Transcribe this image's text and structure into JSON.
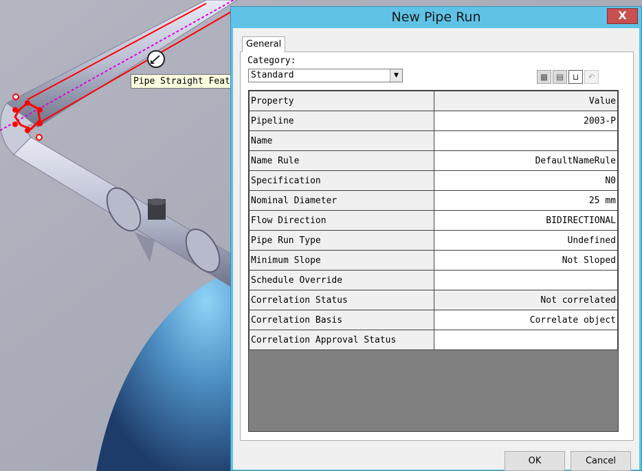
{
  "viewport": {
    "tooltip": "Pipe Straight Feature"
  },
  "dialog": {
    "title": "New Pipe Run",
    "close_label": "X",
    "tab_label": "General",
    "category_label": "Category:",
    "category_value": "Standard",
    "toolbar_icons": [
      "structure-icon",
      "open-folder-icon",
      "pipe-icon",
      "undo-icon"
    ],
    "table_header": {
      "property": "Property",
      "value": "Value"
    },
    "rows": [
      {
        "property": "Pipeline",
        "value": "2003-P"
      },
      {
        "property": "Name",
        "value": ""
      },
      {
        "property": "Name Rule",
        "value": "DefaultNameRule"
      },
      {
        "property": "Specification",
        "value": "N0"
      },
      {
        "property": "Nominal Diameter",
        "value": "25 mm"
      },
      {
        "property": "Flow Direction",
        "value": "BIDIRECTIONAL"
      },
      {
        "property": "Pipe Run Type",
        "value": "Undefined"
      },
      {
        "property": "Minimum Slope",
        "value": "Not Sloped"
      },
      {
        "property": "Schedule Override",
        "value": ""
      },
      {
        "property": "Correlation Status",
        "value": "Not correlated"
      },
      {
        "property": "Correlation Basis",
        "value": "Correlate object"
      },
      {
        "property": "Correlation Approval Status",
        "value": ""
      }
    ],
    "ok_label": "OK",
    "cancel_label": "Cancel"
  }
}
